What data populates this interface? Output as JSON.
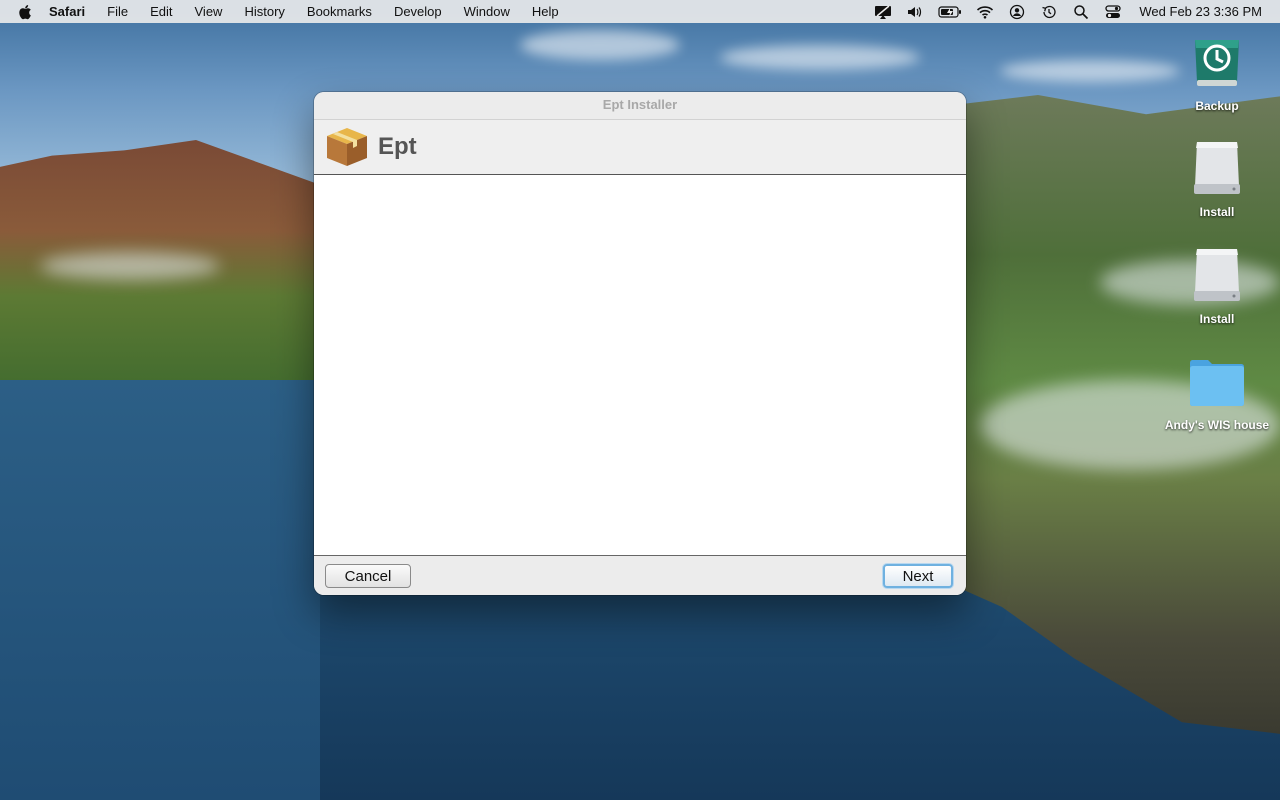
{
  "menubar": {
    "app_name": "Safari",
    "items": [
      "File",
      "Edit",
      "View",
      "History",
      "Bookmarks",
      "Develop",
      "Window",
      "Help"
    ],
    "status_icons": [
      "screen-sharing-icon",
      "volume-icon",
      "battery-icon",
      "wifi-icon",
      "user-icon",
      "time-machine-icon",
      "spotlight-icon",
      "control-center-icon"
    ],
    "clock": "Wed Feb 23  3:36 PM"
  },
  "desktop_icons": [
    {
      "label": "Backup",
      "icon": "time-machine-drive-icon"
    },
    {
      "label": "Install",
      "icon": "disk-icon"
    },
    {
      "label": "Install",
      "icon": "disk-icon"
    },
    {
      "label": "Andy's WIS house",
      "icon": "folder-icon"
    }
  ],
  "installer": {
    "window_title": "Ept Installer",
    "app_title": "Ept",
    "cancel_label": "Cancel",
    "next_label": "Next"
  },
  "colors": {
    "next_button_border": "#6fb1e0",
    "folder": "#5fb3ea"
  }
}
